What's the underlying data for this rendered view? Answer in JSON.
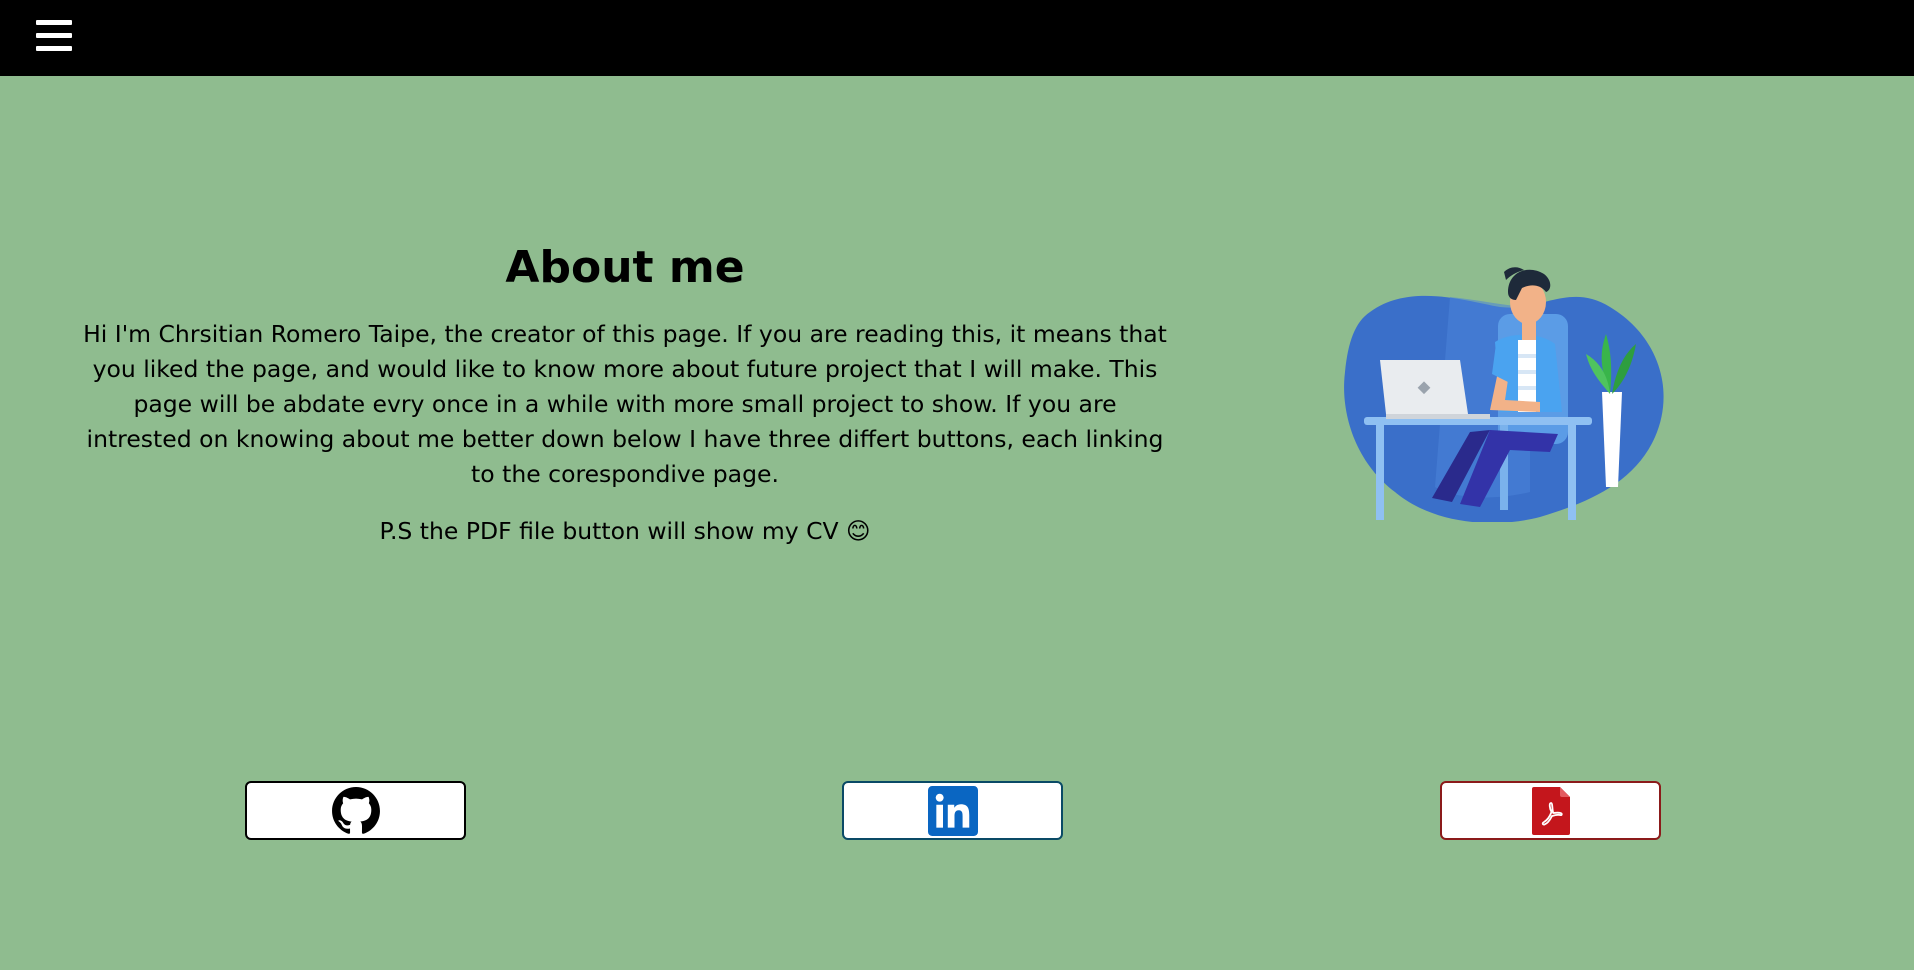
{
  "header": {
    "menu_icon": "hamburger-menu-icon",
    "background": "#000000"
  },
  "page": {
    "background": "#8fbc8f"
  },
  "about": {
    "title": "About me",
    "intro": "Hi I'm Chrsitian Romero Taipe, the creator of this page. If you are reading this, it means that you liked the page, and would like to know more about future project that I will make. This page will be abdate evry once in a while with more small project to show. If you are intrested on knowing about me better down below I have three differt buttons, each linking to the corespondive page.",
    "ps": "P.S the PDF file button will show my CV 😊"
  },
  "illustration": {
    "icon": "person-working-on-laptop-illustration"
  },
  "links": [
    {
      "name": "GitHub",
      "icon": "github-icon",
      "color": "#000000"
    },
    {
      "name": "LinkedIn",
      "icon": "linkedin-icon",
      "color": "#0a66c2"
    },
    {
      "name": "PDF CV",
      "icon": "pdf-file-icon",
      "color": "#c4161c"
    }
  ]
}
